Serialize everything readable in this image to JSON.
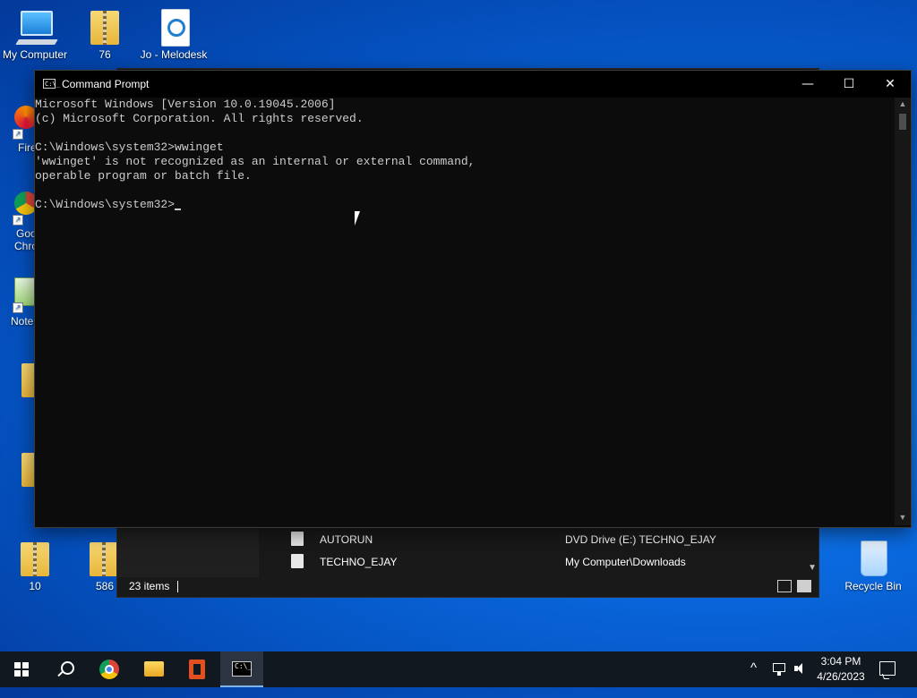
{
  "desktop": {
    "icons_top": [
      {
        "label": "My Computer"
      },
      {
        "label": "76"
      },
      {
        "label": "Jo - Melodesk"
      }
    ],
    "icons_left": [
      {
        "label": "Firef"
      },
      {
        "label": "Goo"
      },
      {
        "label": "Chro"
      },
      {
        "label": "Notep"
      },
      {
        "label": "10"
      },
      {
        "label": "586"
      }
    ],
    "recycle_bin": {
      "label": "Recycle Bin"
    }
  },
  "explorer": {
    "rows": [
      {
        "name": "AUTORUN",
        "location": "DVD Drive (E:) TECHNO_EJAY"
      },
      {
        "name": "TECHNO_EJAY",
        "location": "My Computer\\Downloads"
      }
    ],
    "status": {
      "count": "23 items"
    }
  },
  "cmd": {
    "title": "Command Prompt",
    "icon_text": "C:\\_",
    "controls": {
      "minimize": "—",
      "maximize": "☐",
      "close": "✕"
    },
    "lines": [
      "Microsoft Windows [Version 10.0.19045.2006]",
      "(c) Microsoft Corporation. All rights reserved.",
      "",
      "C:\\Windows\\system32>wwinget",
      "'wwinget' is not recognized as an internal or external command,",
      "operable program or batch file.",
      "",
      "C:\\Windows\\system32>"
    ]
  },
  "taskbar": {
    "clock_time": "3:04 PM",
    "clock_date": "4/26/2023",
    "cmd_icon_text": "C:\\_",
    "tray_chevron": "^"
  }
}
